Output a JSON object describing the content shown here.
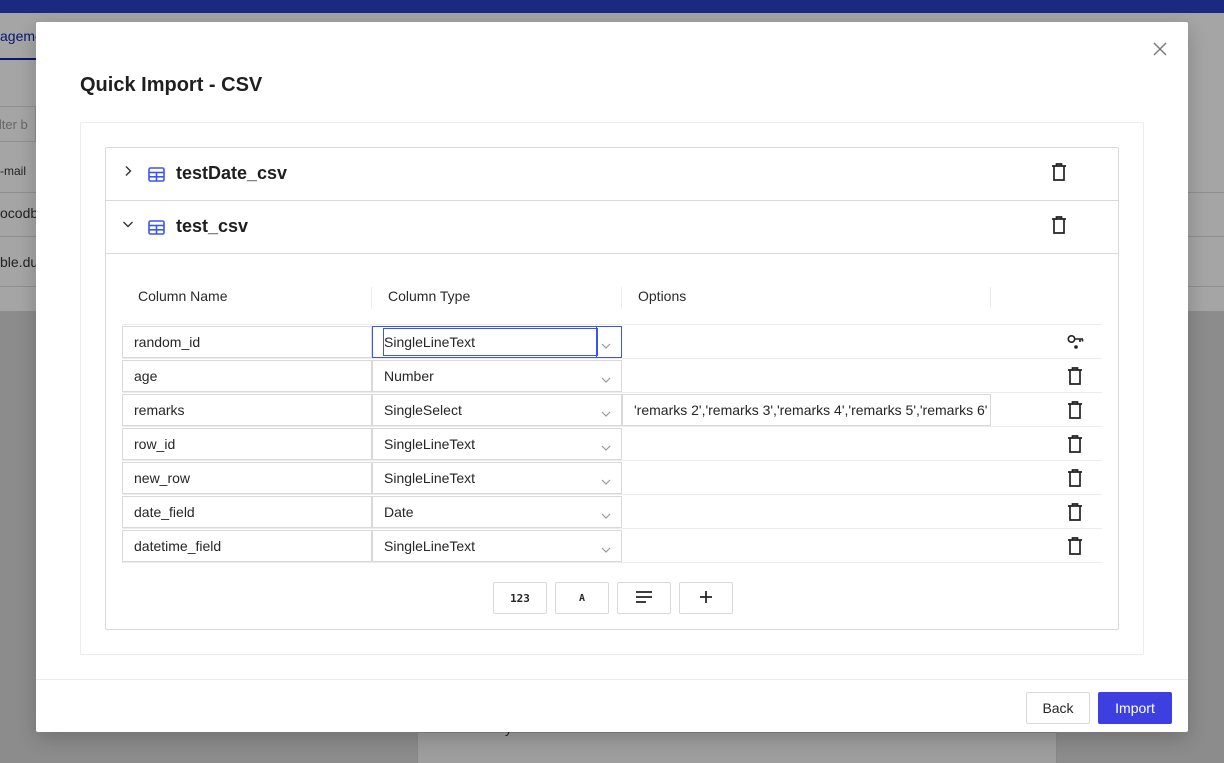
{
  "background": {
    "tab_label": "ageme",
    "filter_placeholder": "ilter b",
    "col_label": "-mail",
    "row1_text": "ocodb",
    "row2_text": "ble.du",
    "lower_text": "y"
  },
  "modal": {
    "title": "Quick Import - CSV",
    "close_icon": "close-icon"
  },
  "tables": [
    {
      "name": "testDate_csv",
      "expanded": false
    },
    {
      "name": "test_csv",
      "expanded": true
    }
  ],
  "columns_header": {
    "name": "Column Name",
    "type": "Column Type",
    "options": "Options"
  },
  "rows": [
    {
      "name": "random_id",
      "type": "SingleLineText",
      "options": "",
      "action_icon": "key-icon"
    },
    {
      "name": "age",
      "type": "Number",
      "options": "",
      "action_icon": "delete-icon"
    },
    {
      "name": "remarks",
      "type": "SingleSelect",
      "options": "'remarks 2','remarks 3','remarks 4','remarks 5','remarks 6'",
      "action_icon": "delete-icon"
    },
    {
      "name": "row_id",
      "type": "SingleLineText",
      "options": "",
      "action_icon": "delete-icon"
    },
    {
      "name": "new_row",
      "type": "SingleLineText",
      "options": "",
      "action_icon": "delete-icon"
    },
    {
      "name": "date_field",
      "type": "Date",
      "options": "",
      "action_icon": "delete-icon"
    },
    {
      "name": "datetime_field",
      "type": "SingleLineText",
      "options": "",
      "action_icon": "delete-icon"
    }
  ],
  "toolbar": {
    "number_label": "123",
    "text_label": "A"
  },
  "footer": {
    "back_label": "Back",
    "import_label": "Import"
  },
  "colors": {
    "primary": "#3d3fe0",
    "focus": "#3d54f5",
    "table_icon": "#3d54f5"
  }
}
